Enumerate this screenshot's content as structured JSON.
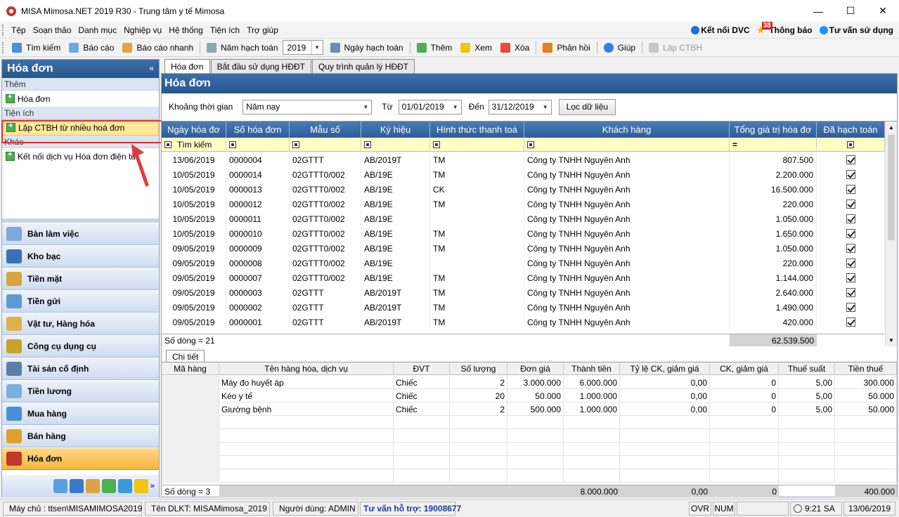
{
  "window": {
    "title": "MISA Mimosa.NET 2019 R30 - Trung tâm y tế Mimosa"
  },
  "menu": {
    "items": [
      "Tệp",
      "Soạn thảo",
      "Danh mục",
      "Nghiệp vụ",
      "Hệ thống",
      "Tiện ích",
      "Trợ giúp"
    ],
    "right": {
      "ket_noi": "Kết nối DVC",
      "badge": "38",
      "thong_bao": "Thông báo",
      "tu_van": "Tư vấn sử dụng"
    }
  },
  "toolbar": {
    "tim_kiem": "Tìm kiếm",
    "bao_cao": "Báo cáo",
    "bao_cao_nhanh": "Báo cáo nhanh",
    "nam_hach_toan": "Năm hạch toán",
    "year": "2019",
    "ngay_hach_toan": "Ngày hạch toán",
    "them": "Thêm",
    "xem": "Xem",
    "xoa": "Xóa",
    "phan_hoi": "Phản hồi",
    "giup": "Giúp",
    "lap_ctbh": "Lập CTBH"
  },
  "left_panel": {
    "title": "Hóa đơn",
    "section_them": "Thêm",
    "item_hoa_don": "Hóa đơn",
    "section_tien_ich": "Tiện ích",
    "item_lap_ctbh": "Lập CTBH từ nhiều hoá đơn",
    "section_khac": "Khác",
    "item_ket_noi": "Kết nối dịch vụ Hóa đơn điện tử",
    "nav": [
      "Bàn làm việc",
      "Kho bạc",
      "Tiền mặt",
      "Tiền gửi",
      "Vật tư, Hàng hóa",
      "Công cụ dụng cụ",
      "Tài sản cố định",
      "Tiền lương",
      "Mua hàng",
      "Bán hàng",
      "Hóa đơn"
    ]
  },
  "tabs": [
    "Hóa đơn",
    "Bắt đầu sử dụng HĐĐT",
    "Quy trình quản lý HĐĐT"
  ],
  "main": {
    "title": "Hóa đơn",
    "filter": {
      "khoang_label": "Khoảng thời gian",
      "khoang_value": "Năm nay",
      "tu_label": "Từ",
      "tu_value": "01/01/2019",
      "den_label": "Đến",
      "den_value": "31/12/2019",
      "loc_button": "Lọc dữ liệu"
    },
    "columns": [
      "Ngày hóa đơ",
      "Số hóa đơn",
      "Mẫu số",
      "Ký hiệu",
      "Hình thức thanh toá",
      "Khách hàng",
      "Tổng giá trị hóa đơ",
      "Đã hạch toán"
    ],
    "search_label": "Tìm kiếm",
    "rows": [
      {
        "date": "13/06/2019",
        "num": "0000004",
        "mau": "02GTTT",
        "kh": "AB/2019T",
        "ht": "TM",
        "cust": "Công ty TNHH Nguyên Anh",
        "total": "807.500"
      },
      {
        "date": "10/05/2019",
        "num": "0000014",
        "mau": "02GTTT0/002",
        "kh": "AB/19E",
        "ht": "TM",
        "cust": "Công ty TNHH Nguyên Anh",
        "total": "2.200.000"
      },
      {
        "date": "10/05/2019",
        "num": "0000013",
        "mau": "02GTTT0/002",
        "kh": "AB/19E",
        "ht": "CK",
        "cust": "Công ty TNHH Nguyên Anh",
        "total": "16.500.000"
      },
      {
        "date": "10/05/2019",
        "num": "0000012",
        "mau": "02GTTT0/002",
        "kh": "AB/19E",
        "ht": "TM",
        "cust": "Công ty TNHH Nguyên Anh",
        "total": "220.000"
      },
      {
        "date": "10/05/2019",
        "num": "0000011",
        "mau": "02GTTT0/002",
        "kh": "AB/19E",
        "ht": "",
        "cust": "Công ty TNHH Nguyên Anh",
        "total": "1.050.000"
      },
      {
        "date": "10/05/2019",
        "num": "0000010",
        "mau": "02GTTT0/002",
        "kh": "AB/19E",
        "ht": "TM",
        "cust": "Công ty TNHH Nguyên Anh",
        "total": "1.650.000"
      },
      {
        "date": "09/05/2019",
        "num": "0000009",
        "mau": "02GTTT0/002",
        "kh": "AB/19E",
        "ht": "TM",
        "cust": "Công ty TNHH Nguyên Anh",
        "total": "1.050.000"
      },
      {
        "date": "09/05/2019",
        "num": "0000008",
        "mau": "02GTTT0/002",
        "kh": "AB/19E",
        "ht": "",
        "cust": "Công ty TNHH Nguyên Anh",
        "total": "220.000"
      },
      {
        "date": "09/05/2019",
        "num": "0000007",
        "mau": "02GTTT0/002",
        "kh": "AB/19E",
        "ht": "TM",
        "cust": "Công ty TNHH Nguyên Anh",
        "total": "1.144.000"
      },
      {
        "date": "09/05/2019",
        "num": "0000003",
        "mau": "02GTTT",
        "kh": "AB/2019T",
        "ht": "TM",
        "cust": "Công ty TNHH Nguyên Anh",
        "total": "2.640.000"
      },
      {
        "date": "09/05/2019",
        "num": "0000002",
        "mau": "02GTTT",
        "kh": "AB/2019T",
        "ht": "TM",
        "cust": "Công ty TNHH Nguyên Anh",
        "total": "1.490.000"
      },
      {
        "date": "09/05/2019",
        "num": "0000001",
        "mau": "02GTTT",
        "kh": "AB/2019T",
        "ht": "TM",
        "cust": "Công ty TNHH Nguyên Anh",
        "total": "420.000"
      }
    ],
    "footer_count": "Số dòng = 21",
    "footer_total": "62.539.500"
  },
  "detail": {
    "tab": "Chi tiết",
    "columns": [
      "Mã hàng",
      "Tên hàng hóa, dịch vụ",
      "ĐVT",
      "Số lượng",
      "Đơn giá",
      "Thành tiền",
      "Tỷ lệ CK, giảm giá",
      "CK, giảm giá",
      "Thuế suất",
      "Tiền thuế"
    ],
    "rows": [
      {
        "ma": "",
        "ten": "Máy đo huyết áp",
        "dvt": "Chiếc",
        "sl": "2",
        "dg": "3.000.000",
        "tt": "6.000.000",
        "tl": "0,00",
        "ck": "0",
        "ts": "5,00",
        "thue": "300.000"
      },
      {
        "ma": "",
        "ten": "Kéo y tế",
        "dvt": "Chiếc",
        "sl": "20",
        "dg": "50.000",
        "tt": "1.000.000",
        "tl": "0,00",
        "ck": "0",
        "ts": "5,00",
        "thue": "50.000"
      },
      {
        "ma": "",
        "ten": "Giường bệnh",
        "dvt": "Chiếc",
        "sl": "2",
        "dg": "500.000",
        "tt": "1.000.000",
        "tl": "0,00",
        "ck": "0",
        "ts": "5,00",
        "thue": "50.000"
      }
    ],
    "footer_count": "Số dòng = 3",
    "footer_tt": "8.000.000",
    "footer_tl": "0,00",
    "footer_ck": "0",
    "footer_thue": "400.000"
  },
  "status": {
    "may_chu": "Máy chủ : ttsen\\MISAMIMOSA2019",
    "dlkt": "Tên DLKT: MISAMimosa_2019",
    "nguoi_dung": "Người dùng: ADMIN",
    "tu_van": "Tư vấn hỗ trợ: 19008677",
    "ovr": "OVR",
    "num": "NUM",
    "time": "9:21 SA",
    "date": "13/06/2019"
  }
}
